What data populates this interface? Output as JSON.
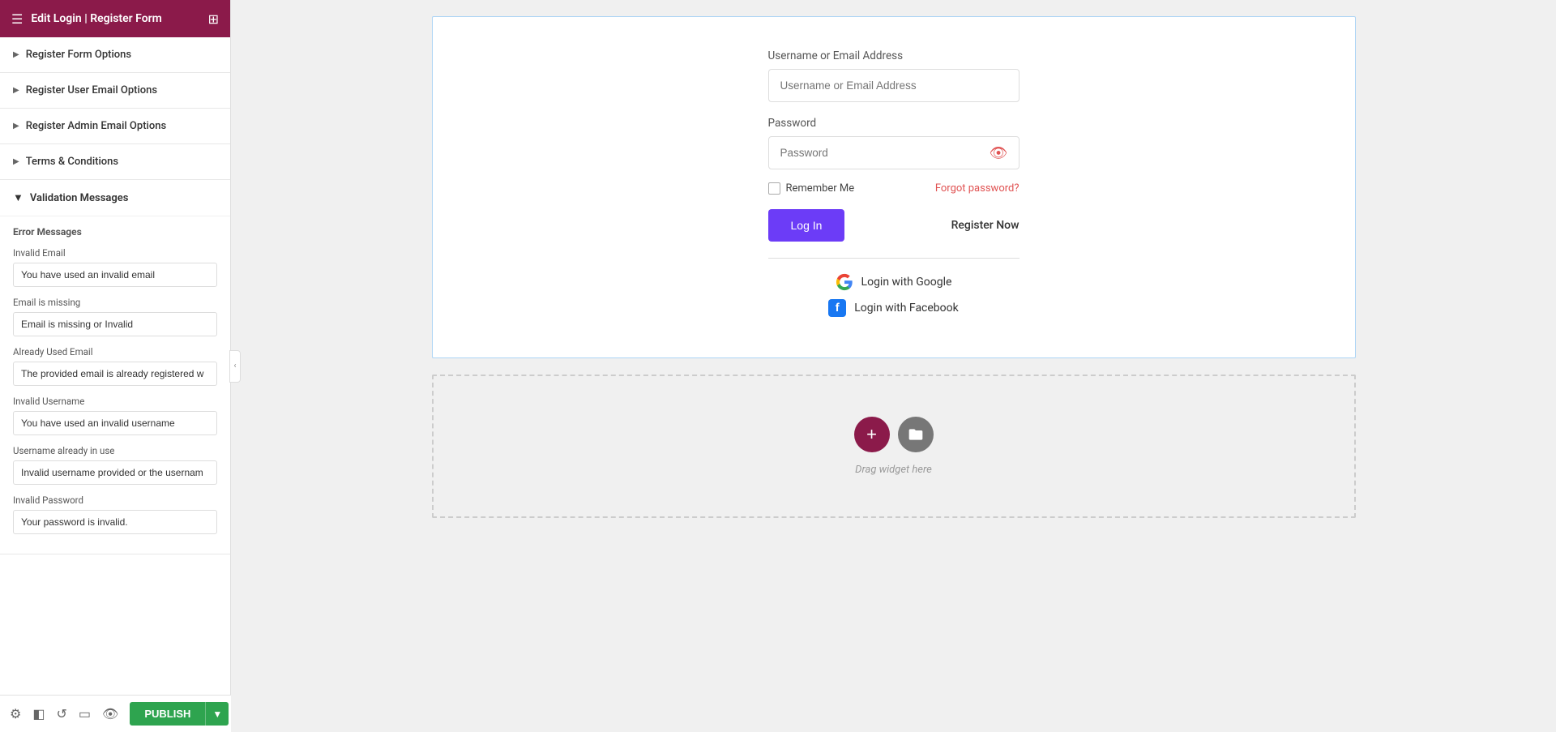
{
  "sidebar": {
    "header": {
      "title": "Edit Login | Register Form",
      "grid_icon": "grid-icon",
      "menu_icon": "menu-icon"
    },
    "sections": [
      {
        "id": "register-form-options",
        "label": "Register Form Options",
        "expanded": false
      },
      {
        "id": "register-user-email-options",
        "label": "Register User Email Options",
        "expanded": false
      },
      {
        "id": "register-admin-email-options",
        "label": "Register Admin Email Options",
        "expanded": false
      },
      {
        "id": "terms-conditions",
        "label": "Terms & Conditions",
        "expanded": false
      }
    ],
    "validation_section": {
      "label": "Validation Messages",
      "error_messages_title": "Error Messages",
      "fields": [
        {
          "id": "invalid-email",
          "label": "Invalid Email",
          "value": "You have used an invalid email"
        },
        {
          "id": "email-missing",
          "label": "Email is missing",
          "value": "Email is missing or Invalid"
        },
        {
          "id": "already-used-email",
          "label": "Already Used Email",
          "value": "The provided email is already registered w"
        },
        {
          "id": "invalid-username",
          "label": "Invalid Username",
          "value": "You have used an invalid username"
        },
        {
          "id": "username-already-in-use",
          "label": "Username already in use",
          "value": "Invalid username provided or the usernam"
        },
        {
          "id": "invalid-password",
          "label": "Invalid Password",
          "value": "Your password is invalid."
        }
      ]
    }
  },
  "login_widget": {
    "username_label": "Username or Email Address",
    "username_placeholder": "Username or Email Address",
    "password_label": "Password",
    "password_placeholder": "Password",
    "remember_me_label": "Remember Me",
    "forgot_password_label": "Forgot password?",
    "login_button_label": "Log In",
    "register_now_label": "Register Now",
    "google_login_label": "Login with Google",
    "facebook_login_label": "Login with Facebook"
  },
  "drop_zone": {
    "text": "Drag widget here"
  },
  "toolbar": {
    "publish_label": "PUBLISH"
  }
}
